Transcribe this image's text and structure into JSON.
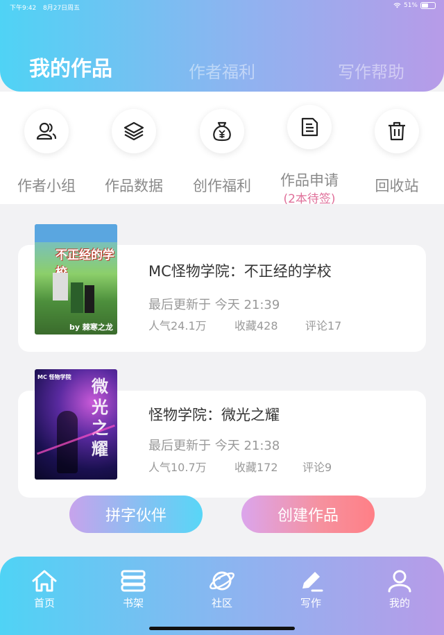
{
  "status_bar": {
    "time": "下午9:42",
    "date": "8月27日周五",
    "battery": "51%"
  },
  "header_tabs": {
    "mine": "我的作品",
    "benefit": "作者福利",
    "help": "写作帮助"
  },
  "quick_entries": [
    {
      "label": "作者小组",
      "icon": "users-icon"
    },
    {
      "label": "作品数据",
      "icon": "layers-icon"
    },
    {
      "label": "创作福利",
      "icon": "money-bag-icon"
    },
    {
      "label": "作品申请",
      "sub": "(2本待签)",
      "icon": "document-icon"
    },
    {
      "label": "回收站",
      "icon": "trash-icon"
    }
  ],
  "works": [
    {
      "cover_text": "不正经的学校",
      "cover_byline": "by 棘寒之龙",
      "title": "MC怪物学院：不正经的学校",
      "updated": "最后更新于 今天 21:39",
      "popularity": "人气24.1万",
      "favorites": "收藏428",
      "comments": "评论17"
    },
    {
      "cover_text": "微光之耀",
      "cover_byline": "MC 怪物学院",
      "title": "怪物学院：微光之耀",
      "updated": "最后更新于 今天 21:38",
      "popularity": "人气10.7万",
      "favorites": "收藏172",
      "comments": "评论9"
    }
  ],
  "buttons": {
    "partner": "拼字伙伴",
    "create": "创建作品"
  },
  "bottom_nav": [
    {
      "label": "首页",
      "icon": "home-icon"
    },
    {
      "label": "书架",
      "icon": "bookshelf-icon"
    },
    {
      "label": "社区",
      "icon": "planet-icon"
    },
    {
      "label": "写作",
      "icon": "pen-icon"
    },
    {
      "label": "我的",
      "icon": "profile-icon"
    }
  ],
  "colors": {
    "accent_cyan": "#4fd3f5",
    "accent_purple": "#b79be8",
    "pending_pink": "#e0709a"
  }
}
